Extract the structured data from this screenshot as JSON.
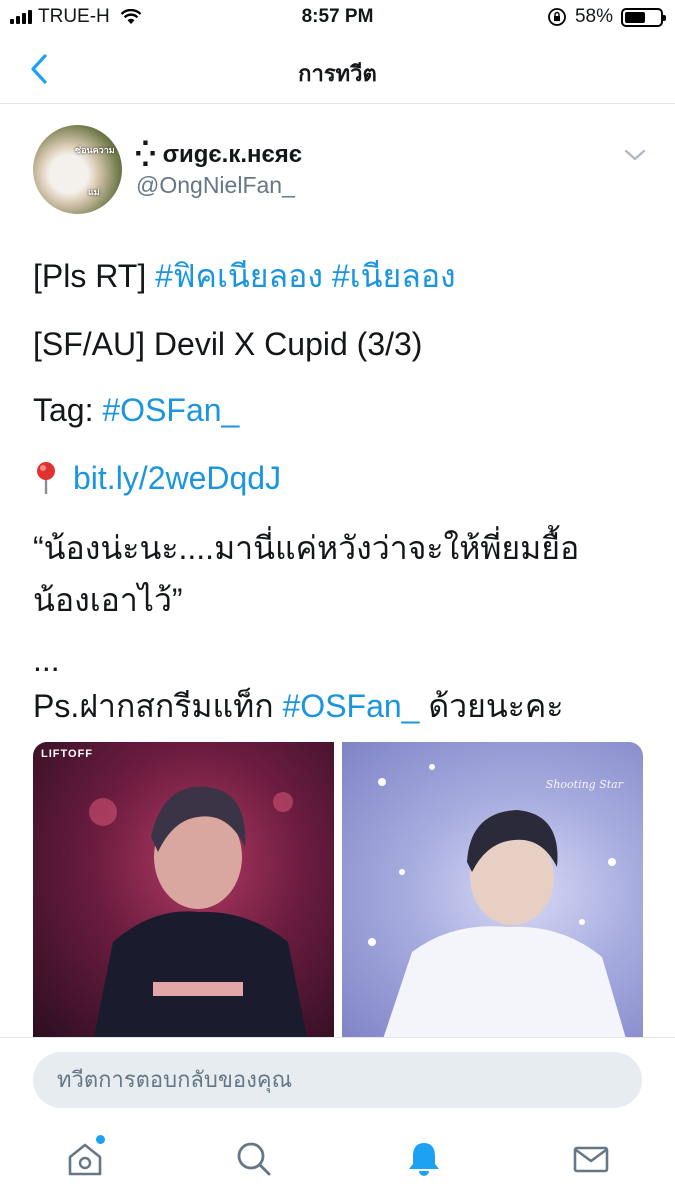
{
  "status_bar": {
    "carrier": "TRUE-H",
    "time": "8:57 PM",
    "battery_percent": "58%",
    "battery_level": 0.58,
    "icons": [
      "signal-icon",
      "wifi-icon",
      "orientation-lock-icon",
      "battery-icon"
    ]
  },
  "nav": {
    "title": "การทวีต",
    "back_icon": "chevron-left-icon"
  },
  "tweet": {
    "author": {
      "display_name": "⁛ σиgє.к.нєяє",
      "handle": "@OngNielFan_",
      "avatar_caption_1": "ซ่อนความ",
      "avatar_caption_2": "แม่"
    },
    "lines": {
      "line1_prefix": "[Pls RT] ",
      "line1_tag1": "#ฟิคเนียลอง",
      "line1_space": " ",
      "line1_tag2": "#เนียลอง",
      "line2": "[SF/AU] Devil X Cupid (3/3)",
      "line3_prefix": "Tag:  ",
      "line3_tag": "#OSFan_",
      "line4_link": "bit.ly/2weDqdJ",
      "line5": "“น้องน่ะนะ....มานี่แค่หวังว่าจะให้พี่ยมยื้อ",
      "line6": "น้องเอาไว้”",
      "line7": "...",
      "line8_prefix": "Ps.ฝากสกรีมแท็ก ",
      "line8_tag": "#OSFan_",
      "line8_suffix": " ด้วยนะคะ"
    },
    "media": {
      "photo1_label": "LIFTOFF",
      "photo2_watermark": "Shooting Star"
    }
  },
  "reply": {
    "placeholder": "ทวีตการตอบกลับของคุณ"
  },
  "tab_bar": {
    "tabs": [
      "home-icon",
      "search-icon",
      "notifications-icon",
      "messages-icon"
    ],
    "active": "notifications-icon",
    "accent": "#1da1f2"
  },
  "colors": {
    "link": "#1b95e0",
    "secondary_text": "#657786",
    "reply_bg": "#e6ecf0"
  }
}
